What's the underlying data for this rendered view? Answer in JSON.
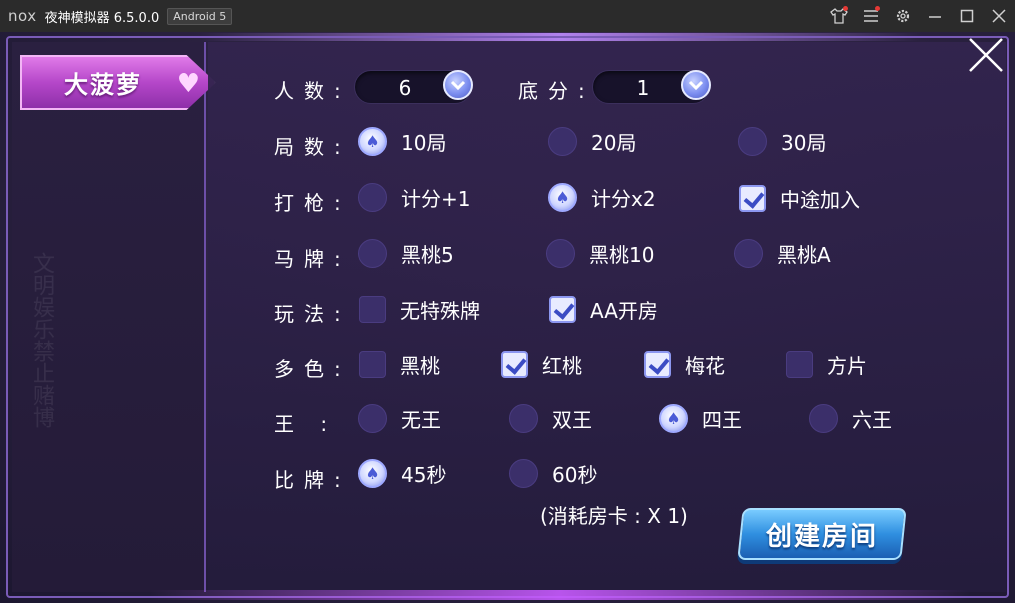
{
  "window": {
    "logo": "nox",
    "title": "夜神模拟器 6.5.0.0",
    "android_badge": "Android 5",
    "icons": [
      "shirt-icon",
      "menu-icon",
      "gear-icon",
      "minimize-icon",
      "maximize-icon",
      "close-icon"
    ]
  },
  "left_panel": {
    "selected_tab": "大菠萝",
    "ghost_text": "文明娱乐禁止赌博"
  },
  "settings": {
    "people": {
      "label": "人数:",
      "value": "6"
    },
    "base": {
      "label": "底分:",
      "value": "1"
    },
    "rounds": {
      "label": "局数:",
      "options": [
        {
          "label": "10局",
          "checked": true
        },
        {
          "label": "20局",
          "checked": false
        },
        {
          "label": "30局",
          "checked": false
        }
      ]
    },
    "shoot": {
      "label": "打枪:",
      "options": [
        {
          "label": "计分+1",
          "checked": false
        },
        {
          "label": "计分x2",
          "checked": true
        },
        {
          "label": "中途加入",
          "checked": true
        }
      ]
    },
    "horse": {
      "label": "马牌:",
      "options": [
        {
          "label": "黑桃5",
          "checked": false
        },
        {
          "label": "黑桃10",
          "checked": false
        },
        {
          "label": "黑桃A",
          "checked": false
        }
      ]
    },
    "play": {
      "label": "玩法:",
      "options": [
        {
          "label": "无特殊牌",
          "checked": false
        },
        {
          "label": "AA开房",
          "checked": true
        }
      ]
    },
    "colors": {
      "label": "多色:",
      "options": [
        {
          "label": "黑桃",
          "checked": false
        },
        {
          "label": "红桃",
          "checked": true
        },
        {
          "label": "梅花",
          "checked": true
        },
        {
          "label": "方片",
          "checked": false
        }
      ]
    },
    "kings": {
      "label": "王 :",
      "options": [
        {
          "label": "无王",
          "checked": false
        },
        {
          "label": "双王",
          "checked": false
        },
        {
          "label": "四王",
          "checked": true
        },
        {
          "label": "六王",
          "checked": false
        }
      ]
    },
    "compare": {
      "label": "比牌:",
      "options": [
        {
          "label": "45秒",
          "checked": true
        },
        {
          "label": "60秒",
          "checked": false
        }
      ]
    }
  },
  "cost_note": "(消耗房卡 : X 1)",
  "create_button": "创建房间",
  "colors": {
    "accent_purple": "#b547c9",
    "button_blue": "#2f8fe0",
    "radio_on": "#cfd6ff"
  }
}
